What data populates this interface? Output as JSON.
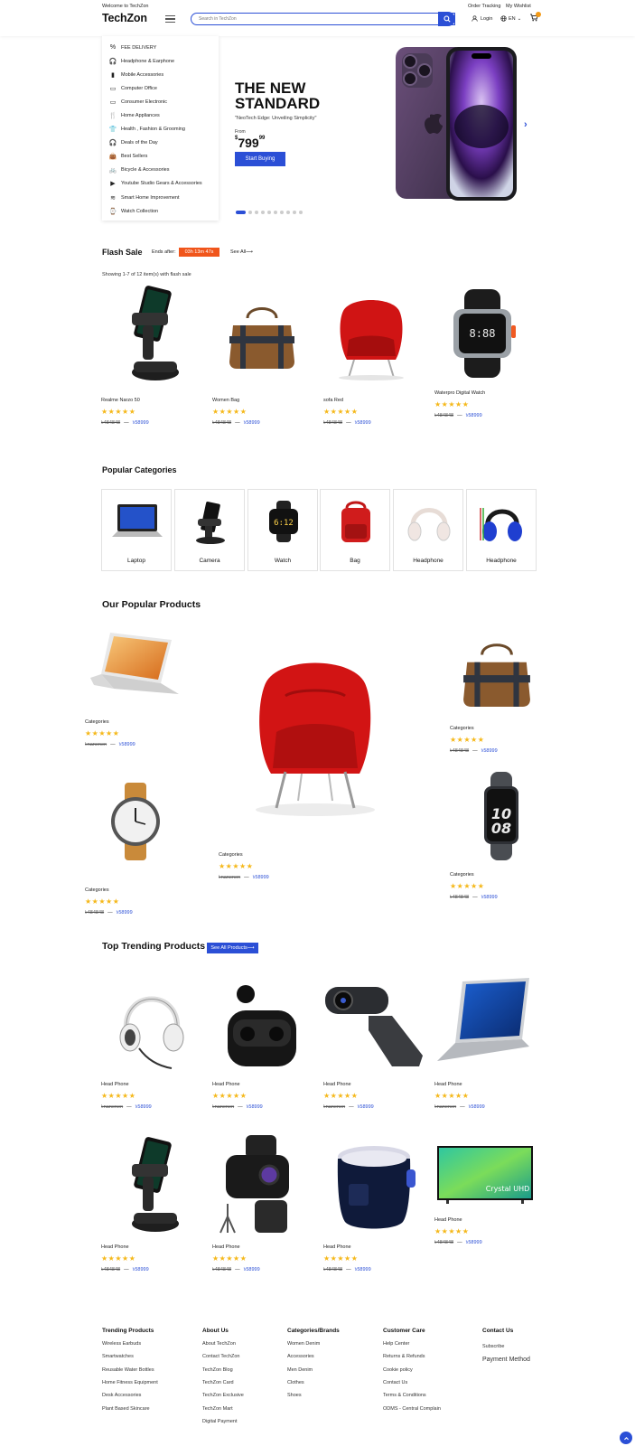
{
  "header": {
    "welcome": "Welcome to TechZon",
    "logo": "TechZon",
    "search_placeholder": "Search in TechZon",
    "order_tracking": "Order Tracking",
    "wishlist": "My Wishlist",
    "login": "Login",
    "language": "EN"
  },
  "sidebar": {
    "items": [
      {
        "label": "FEE DELIVERY",
        "icon": "percent-icon"
      },
      {
        "label": "Headphone & Earphone",
        "icon": "headphone-icon"
      },
      {
        "label": "Mobile Accessories",
        "icon": "mobile-icon"
      },
      {
        "label": "Computer Office",
        "icon": "computer-icon"
      },
      {
        "label": "Consumer Electronic",
        "icon": "monitor-icon"
      },
      {
        "label": "Home Appliances",
        "icon": "utensils-icon"
      },
      {
        "label": "Health , Fashion & Grooming",
        "icon": "shirt-icon"
      },
      {
        "label": "Deals of the Day",
        "icon": "headset-icon"
      },
      {
        "label": "Best Sellers",
        "icon": "bag-icon"
      },
      {
        "label": "Bicycle & Accessories",
        "icon": "car-icon"
      },
      {
        "label": "Youtube Studio Gears & Accessories",
        "icon": "video-icon"
      },
      {
        "label": "Smart Home Improvement",
        "icon": "wifi-icon"
      },
      {
        "label": "Watch Collection",
        "icon": "watch-icon"
      }
    ]
  },
  "hero": {
    "title": "THE NEW STANDARD",
    "subtitle": "\"NeoTech Edge: Unveiling Simplicity\"",
    "from_label": "From",
    "price_currency": "$",
    "price_main": "799",
    "price_cents": "99",
    "button": "Start Buying",
    "active_slide": 1,
    "slide_count": 10
  },
  "flash_sale": {
    "title": "Flash Sale",
    "ends_after": "Ends after:",
    "timer": "03h 13m 47s",
    "see_all": "See All",
    "showing": "Showing 1-7 of 12 item(s) with flash sale",
    "products": [
      {
        "name": "Realme Narzo 50",
        "old_price": "৳484848",
        "sep": "—",
        "new_price": "৳58999"
      },
      {
        "name": "Women Bag",
        "old_price": "৳484848",
        "sep": "—",
        "new_price": "৳58999"
      },
      {
        "name": "sofa Red",
        "old_price": "৳484848",
        "sep": "—",
        "new_price": "৳58999"
      },
      {
        "name": "Waterpro Digital Watch",
        "old_price": "৳484848",
        "sep": "—",
        "new_price": "৳58999"
      }
    ]
  },
  "categories": {
    "title": "Popular Categories",
    "items": [
      "Laptop",
      "Camera",
      "Watch",
      "Bag",
      "Headphone",
      "Headphone"
    ]
  },
  "popular": {
    "title": "Our Popular Products",
    "products": [
      {
        "name": "Categories",
        "old_price": "৳nanenen",
        "sep": "—",
        "new_price": "৳58999"
      },
      {
        "name": "Categories",
        "old_price": "৳484848",
        "sep": "—",
        "new_price": "৳58999"
      },
      {
        "name": "Categories",
        "old_price": "৳nanenen",
        "sep": "—",
        "new_price": "৳58999"
      },
      {
        "name": "Categories",
        "old_price": "৳484848",
        "sep": "—",
        "new_price": "৳58999"
      },
      {
        "name": "Categories",
        "old_price": "৳484848",
        "sep": "—",
        "new_price": "৳58999"
      }
    ]
  },
  "trending": {
    "title": "Top Trending Products",
    "button": "See All Products",
    "products": [
      {
        "name": "Head Phone",
        "old_price": "৳nanenen",
        "sep": "—",
        "new_price": "৳58999"
      },
      {
        "name": "Head Phone",
        "old_price": "৳nanenen",
        "sep": "—",
        "new_price": "৳58999"
      },
      {
        "name": "Head Phone",
        "old_price": "৳nanenen",
        "sep": "—",
        "new_price": "৳58999"
      },
      {
        "name": "Head Phone",
        "old_price": "৳nanenen",
        "sep": "—",
        "new_price": "৳58999"
      },
      {
        "name": "Head Phone",
        "old_price": "৳484848",
        "sep": "—",
        "new_price": "৳58999"
      },
      {
        "name": "Head Phone",
        "old_price": "৳484848",
        "sep": "—",
        "new_price": "৳58999"
      },
      {
        "name": "Head Phone",
        "old_price": "৳484848",
        "sep": "—",
        "new_price": "৳58999"
      },
      {
        "name": "Head Phone",
        "old_price": "৳484848",
        "sep": "—",
        "new_price": "৳58999"
      }
    ]
  },
  "rating_stars": "★★★★★",
  "footer": {
    "trending": {
      "title": "Trending Products",
      "links": [
        "Wireless Earbuds",
        "Smartwatches",
        "Reusable Water Bottles",
        "Home Fitness Equipment",
        "Desk Accessories",
        "Plant Based Skincare"
      ]
    },
    "about": {
      "title": "About Us",
      "links": [
        "About TechZon",
        "Contact TechZon",
        "TechZon Blog",
        "TechZon Card",
        "TechZon Exclusive",
        "TechZon Mart",
        "Digital Payment"
      ]
    },
    "brands": {
      "title": "Categories/Brands",
      "links": [
        "Women Denim",
        "Accessories",
        "Men Denim",
        "Clothes",
        "Shoes"
      ]
    },
    "care": {
      "title": "Customer Care",
      "links": [
        "Help Center",
        "Returns & Refunds",
        "Cookie policy",
        "Contact Us",
        "Terms & Conditions",
        "ODMS - Central Complain"
      ]
    },
    "contact": {
      "title": "Contact Us",
      "subscribe": "Subscribe",
      "payment": "Payment Method"
    }
  },
  "colors": {
    "accent": "#2b4fd6",
    "timer": "#f0551b",
    "star": "#f5b81a"
  }
}
